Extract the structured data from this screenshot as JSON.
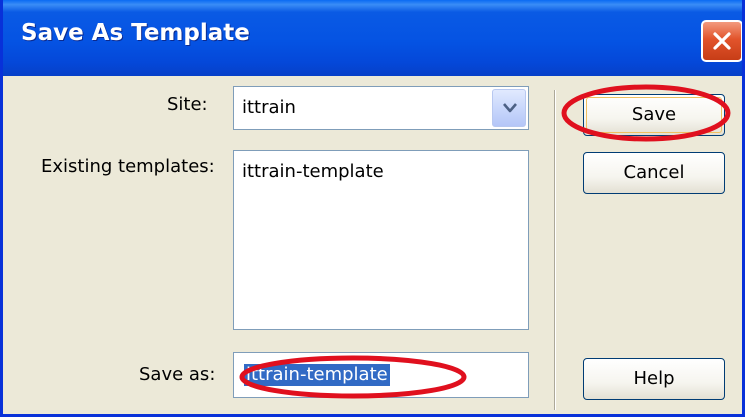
{
  "window": {
    "title": "Save As Template"
  },
  "form": {
    "site_label": "Site:",
    "site_value": "ittrain",
    "existing_label": "Existing templates:",
    "existing_items": [
      "ittrain-template"
    ],
    "saveas_label": "Save as:",
    "saveas_value": "ittrain-template"
  },
  "buttons": {
    "save": "Save",
    "cancel": "Cancel",
    "help": "Help"
  },
  "icons": {
    "close": "close-icon",
    "dropdown": "chevron-down-icon",
    "annotation": "red-ellipse-highlight"
  },
  "colors": {
    "titlebar": "#0553e3",
    "dialog_bg": "#ece9d8",
    "selection": "#316ac5",
    "annotation": "#e0101e",
    "close": "#e2542b"
  }
}
